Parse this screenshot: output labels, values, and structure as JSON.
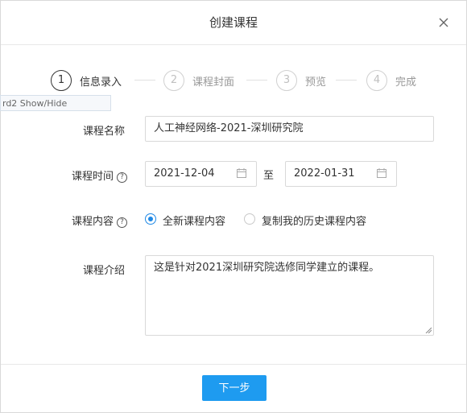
{
  "dialog": {
    "title": "创建课程",
    "close_icon": "close-icon"
  },
  "steps": [
    {
      "number": "1",
      "label": "信息录入",
      "active": true
    },
    {
      "number": "2",
      "label": "课程封面",
      "active": false
    },
    {
      "number": "3",
      "label": "预览",
      "active": false
    },
    {
      "number": "4",
      "label": "完成",
      "active": false
    }
  ],
  "tooltip": {
    "text": "rd2 Show/Hide"
  },
  "form": {
    "name_label": "课程名称",
    "name_value": "人工神经网络-2021-深圳研究院",
    "time_label": "课程时间",
    "help_icon": "question-circle-icon",
    "help_symbol": "?",
    "start_date": "2021-12-04",
    "to_label": "至",
    "end_date": "2022-01-31",
    "calendar_icon": "calendar-icon",
    "content_label": "课程内容",
    "content_options": [
      {
        "label": "全新课程内容",
        "checked": true
      },
      {
        "label": "复制我的历史课程内容",
        "checked": false
      }
    ],
    "intro_label": "课程介绍",
    "intro_value": "这是针对2021深圳研究院选修同学建立的课程。"
  },
  "footer": {
    "next_label": "下一步"
  },
  "colors": {
    "accent": "#1e88e5",
    "primary_button": "#1e9bf0",
    "border": "#d9d9d9"
  }
}
